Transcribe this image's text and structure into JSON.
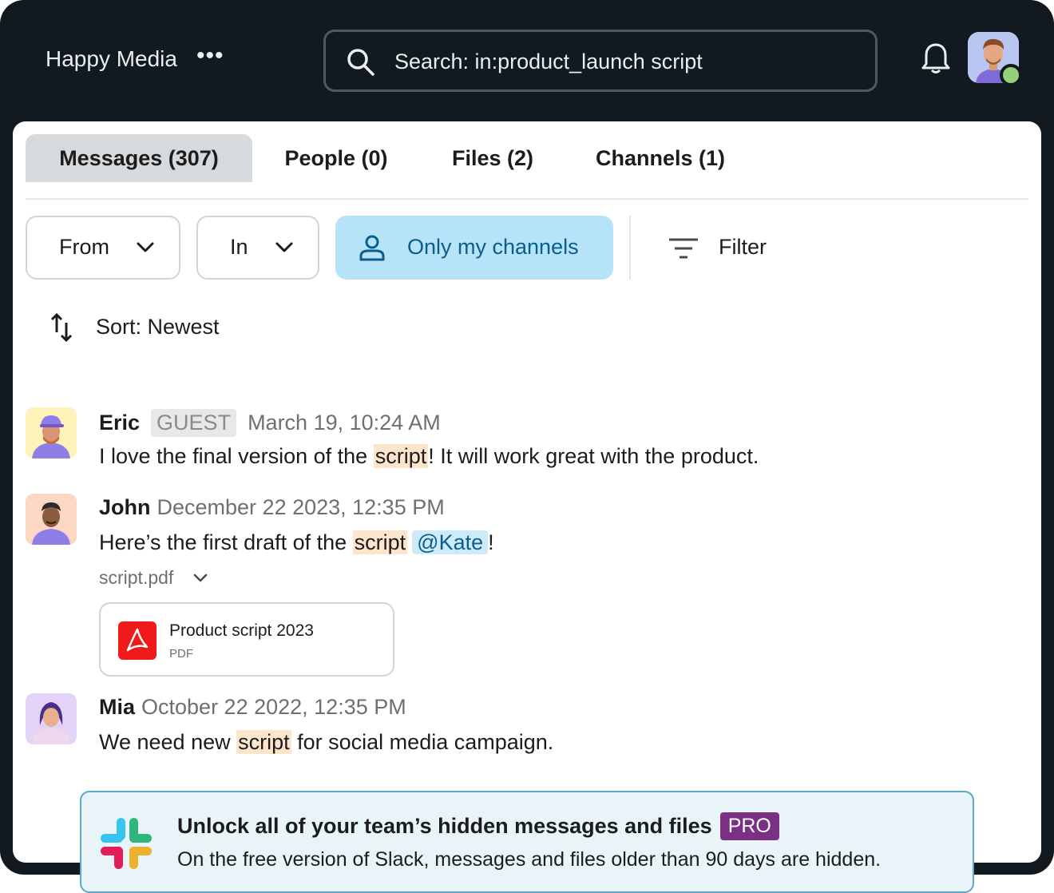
{
  "header": {
    "workspace_name": "Happy Media",
    "more_icon": "ellipsis-icon",
    "search_query": "Search: in:product_launch script",
    "search_icon": "search-icon",
    "notifications_icon": "bell-icon",
    "user_status": "online"
  },
  "tabs": [
    {
      "label": "Messages (307)",
      "active": true
    },
    {
      "label": "People (0)",
      "active": false
    },
    {
      "label": "Files (2)",
      "active": false
    },
    {
      "label": "Channels (1)",
      "active": false
    }
  ],
  "filters": {
    "from_label": "From",
    "in_label": "In",
    "only_my_channels_label": "Only my channels",
    "filter_label": "Filter"
  },
  "sort": {
    "label": "Sort: Newest"
  },
  "messages": [
    {
      "name": "Eric",
      "badge": "GUEST",
      "time": "March 19, 10:24 AM",
      "text_before": "I love the final version of the ",
      "highlight": "script",
      "text_after": "! It will work great with the product."
    },
    {
      "name": "John",
      "time": "December 22 2023, 12:35 PM",
      "text_before": "Here’s the first draft of the ",
      "highlight": "script",
      "mention": "@Kate",
      "text_after": "!",
      "attachment": {
        "filename": "script.pdf",
        "title": "Product script 2023",
        "type": "PDF"
      }
    },
    {
      "name": "Mia",
      "time": "October 22 2022, 12:35 PM",
      "text_before": "We need new ",
      "highlight": "script",
      "text_after": " for social media campaign."
    }
  ],
  "upsell": {
    "title": "Unlock all of your team’s hidden messages and files",
    "badge": "PRO",
    "body": "On the free version of Slack, messages and files older than 90 days are hidden."
  },
  "colors": {
    "header_bg": "#121a1f",
    "active_chip_bg": "#b7e3f9",
    "highlight_bg": "#fde5cc",
    "mention_bg": "#cdeaf9",
    "pro_badge": "#7a3184",
    "presence": "#94d17a"
  }
}
